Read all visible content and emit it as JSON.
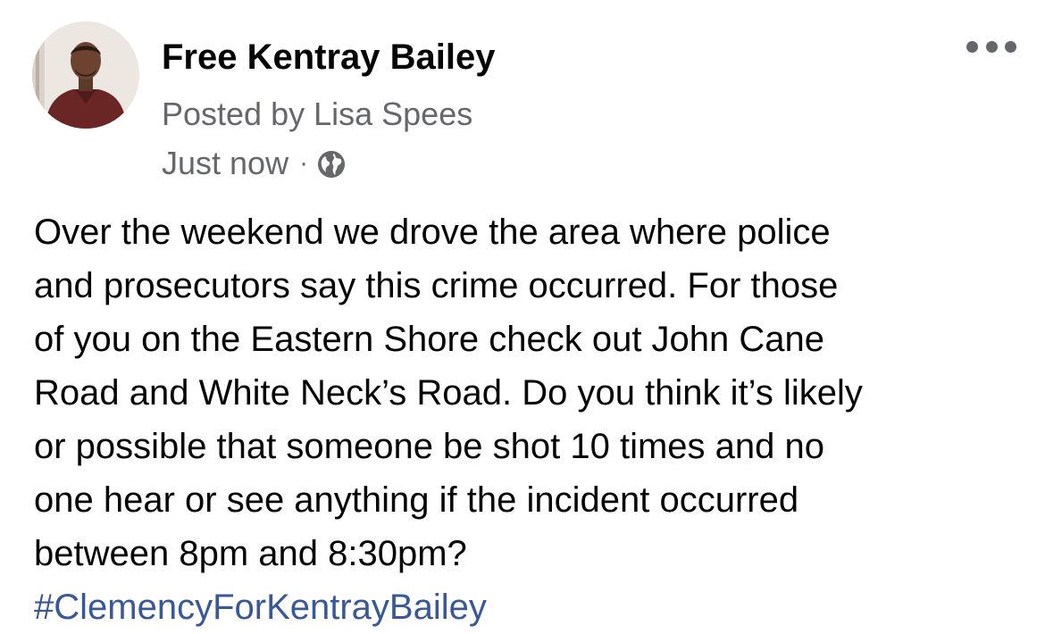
{
  "post": {
    "page_name": "Free Kentray Bailey",
    "posted_by": "Posted by Lisa Spees",
    "timestamp": "Just now",
    "separator": "·",
    "audience_icon": "globe-icon",
    "more_icon": "more-options-icon",
    "body_lines": [
      "Over the weekend we drove the area where police",
      "and prosecutors say this crime occurred. For those",
      "of you on the Eastern Shore check out John Cane",
      "Road and White Neck’s Road. Do you think it’s likely",
      "or possible that someone be shot 10 times and no",
      "one hear or see anything if the incident occurred",
      "between 8pm and 8:30pm?"
    ],
    "hashtag": "#ClemencyForKentrayBailey"
  },
  "colors": {
    "text": "#050505",
    "secondary_text": "#65676b",
    "link": "#385898",
    "background": "#ffffff"
  }
}
